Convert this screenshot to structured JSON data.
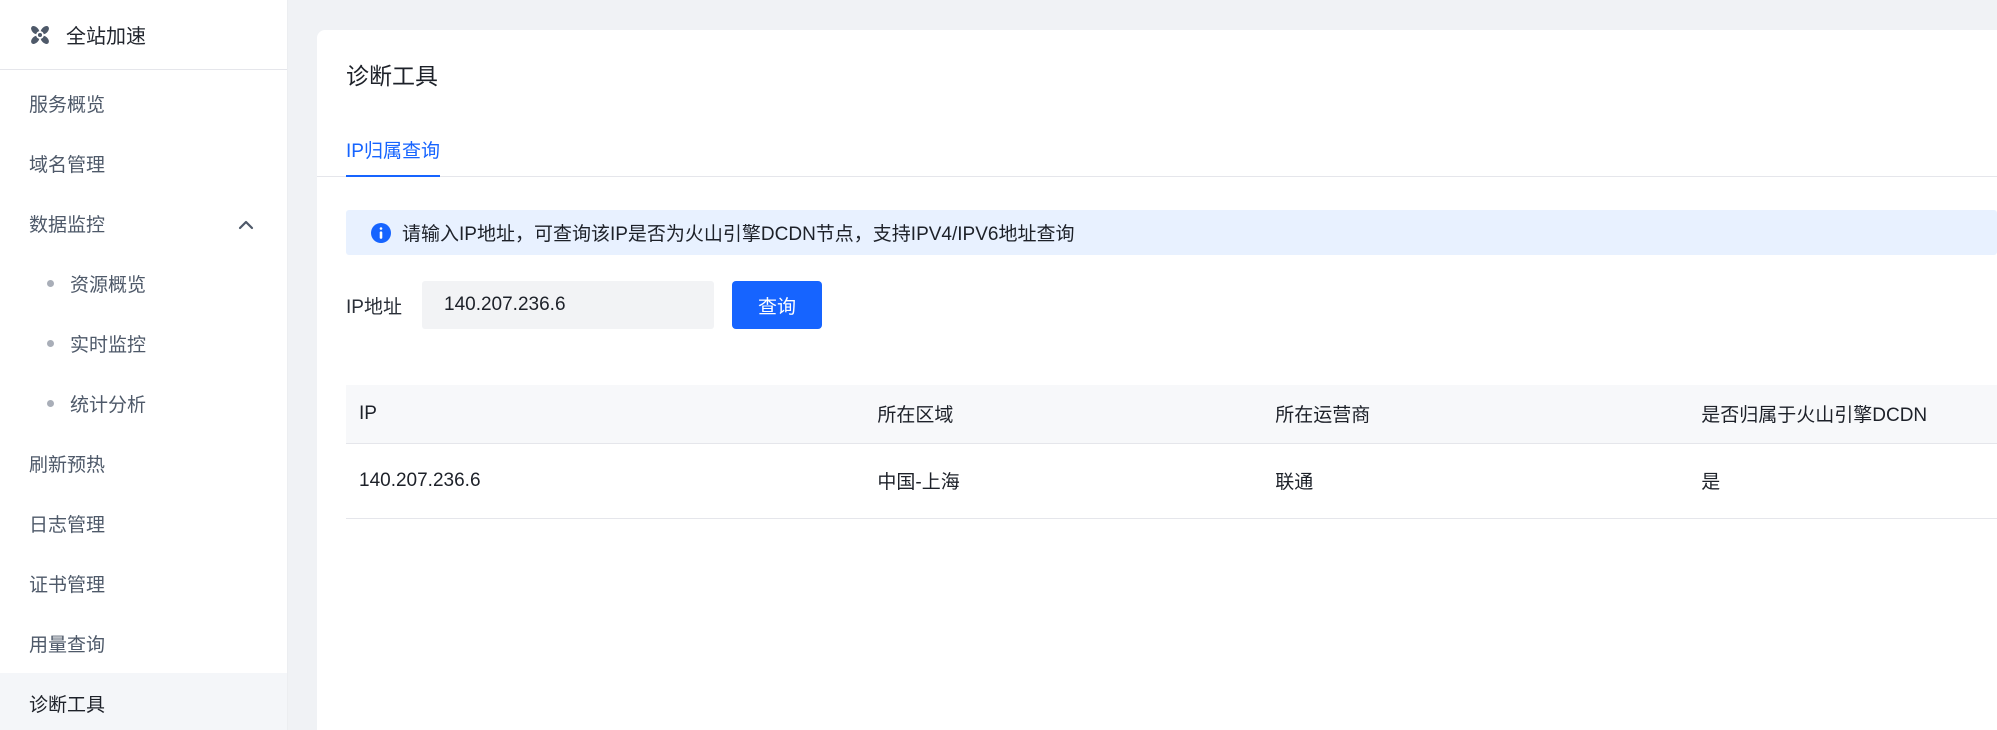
{
  "sidebar": {
    "product": {
      "name": "全站加速"
    },
    "items": [
      {
        "label": "服务概览"
      },
      {
        "label": "域名管理"
      },
      {
        "label": "数据监控",
        "expanded": true,
        "children": [
          {
            "label": "资源概览"
          },
          {
            "label": "实时监控"
          },
          {
            "label": "统计分析"
          }
        ]
      },
      {
        "label": "刷新预热"
      },
      {
        "label": "日志管理"
      },
      {
        "label": "证书管理"
      },
      {
        "label": "用量查询"
      },
      {
        "label": "诊断工具",
        "active": true
      }
    ]
  },
  "main": {
    "title": "诊断工具",
    "tabs": [
      {
        "label": "IP归属查询",
        "active": true
      }
    ],
    "alert": {
      "icon": "info-circle-filled",
      "text": "请输入IP地址，可查询该IP是否为火山引擎DCDN节点，支持IPV4/IPV6地址查询"
    },
    "form": {
      "label": "IP地址",
      "input_value": "140.207.236.6",
      "submit_label": "查询"
    },
    "table": {
      "columns": [
        "IP",
        "所在区域",
        "所在运营商",
        "是否归属于火山引擎DCDN"
      ],
      "rows": [
        [
          "140.207.236.6",
          "中国-上海",
          "联通",
          "是"
        ]
      ]
    }
  },
  "colors": {
    "accent": "#1664ff",
    "alert_bg": "#e8f1ff",
    "page_bg": "#f0f2f5",
    "table_header_bg": "#f7f8fa",
    "text_primary": "#1d2129",
    "text_secondary": "#4e5969",
    "divider": "#e5e6eb",
    "selected_item_bg": "#f4f6f9"
  }
}
